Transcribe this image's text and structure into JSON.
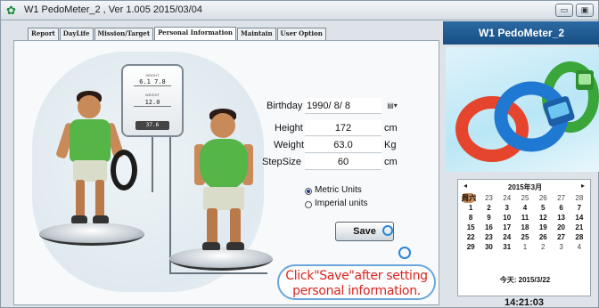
{
  "window": {
    "title": "W1  PedoMeter_2 , Ver 1.005   2015/03/04",
    "minimize_glyph": "▭",
    "close_glyph": "▣"
  },
  "tabs": [
    {
      "label": "Report",
      "active": false
    },
    {
      "label": "DayLife",
      "active": false
    },
    {
      "label": "Mission/Target",
      "active": false
    },
    {
      "label": "Personal Information",
      "active": true
    },
    {
      "label": "Maintain",
      "active": false
    },
    {
      "label": "User Option",
      "active": false
    }
  ],
  "scale_card": {
    "height_label": "HEIGHT",
    "height_value": "6.1  7.8",
    "weight_label": "WEIGHT",
    "weight_value": "12.0",
    "footer_value": "37.6"
  },
  "form": {
    "birthday_label": "Birthday",
    "birthday_value": "1990/  8/  8",
    "birthday_picker_icon": "calendar-dropdown-icon",
    "height_label": "Height",
    "height_value": "172",
    "height_unit": "cm",
    "weight_label": "Weight",
    "weight_value": "63.0",
    "weight_unit": "Kg",
    "stepsize_label": "StepSize",
    "stepsize_value": "60",
    "stepsize_unit": "cm",
    "units": {
      "metric_label": "Metric Units",
      "imperial_label": "Imperial units",
      "selected": "metric"
    },
    "save_label": "Save"
  },
  "callout": {
    "line1": "Click\"Save\"after setting",
    "line2": "personal information."
  },
  "right_panel": {
    "title": "W1  PedoMeter_2"
  },
  "calendar": {
    "month_label": "2015年3月",
    "prev": "◂",
    "next": "▸",
    "weekdays": [
      "日",
      "周一",
      "周二",
      "周三",
      "周四",
      "周五",
      "周六"
    ],
    "weeks": [
      [
        "22",
        "23",
        "24",
        "25",
        "26",
        "27",
        "28"
      ],
      [
        "1",
        "2",
        "3",
        "4",
        "5",
        "6",
        "7"
      ],
      [
        "8",
        "9",
        "10",
        "11",
        "12",
        "13",
        "14"
      ],
      [
        "15",
        "16",
        "17",
        "18",
        "19",
        "20",
        "21"
      ],
      [
        "22",
        "23",
        "24",
        "25",
        "26",
        "27",
        "28"
      ],
      [
        "29",
        "30",
        "31",
        "1",
        "2",
        "3",
        "4"
      ]
    ],
    "today_label": "今天: 2015/3/22"
  },
  "clock": "14:21:03",
  "colors": {
    "title_blue": "#1f5a94",
    "callout_red": "#d8261f",
    "band_red": "#e5452c",
    "band_blue": "#1f78d1",
    "band_green": "#3aa63a"
  }
}
